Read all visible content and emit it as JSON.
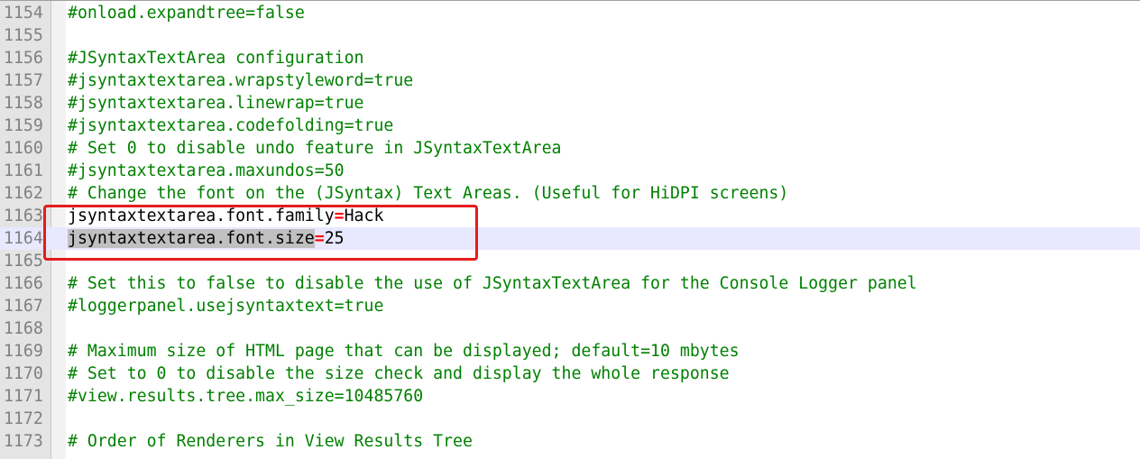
{
  "editor": {
    "lines": [
      {
        "num": "1154",
        "comment": "#onload.expandtree=false"
      },
      {
        "num": "1155",
        "comment": ""
      },
      {
        "num": "1156",
        "comment": "#JSyntaxTextArea configuration"
      },
      {
        "num": "1157",
        "comment": "#jsyntaxtextarea.wrapstyleword=true"
      },
      {
        "num": "1158",
        "comment": "#jsyntaxtextarea.linewrap=true"
      },
      {
        "num": "1159",
        "comment": "#jsyntaxtextarea.codefolding=true"
      },
      {
        "num": "1160",
        "comment": "# Set 0 to disable undo feature in JSyntaxTextArea"
      },
      {
        "num": "1161",
        "comment": "#jsyntaxtextarea.maxundos=50"
      },
      {
        "num": "1162",
        "comment": "# Change the font on the (JSyntax) Text Areas. (Useful for HiDPI screens)"
      },
      {
        "num": "1163",
        "key": "jsyntaxtextarea.font.family",
        "op": "=",
        "value": "Hack"
      },
      {
        "num": "1164",
        "key": "jsyntaxtextarea.font.size",
        "op": "=",
        "value": "25"
      },
      {
        "num": "1165",
        "comment": ""
      },
      {
        "num": "1166",
        "comment": "# Set this to false to disable the use of JSyntaxTextArea for the Console Logger panel"
      },
      {
        "num": "1167",
        "comment": "#loggerpanel.usejsyntaxtext=true"
      },
      {
        "num": "1168",
        "comment": ""
      },
      {
        "num": "1169",
        "comment": "# Maximum size of HTML page that can be displayed; default=10 mbytes"
      },
      {
        "num": "1170",
        "comment": "# Set to 0 to disable the size check and display the whole response"
      },
      {
        "num": "1171",
        "comment": "#view.results.tree.max_size=10485760"
      },
      {
        "num": "1172",
        "comment": ""
      },
      {
        "num": "1173",
        "comment": "# Order of Renderers in View Results Tree"
      }
    ]
  },
  "colors": {
    "comment": "#008000",
    "operator": "#ff0000",
    "current_line": "#e8e8ff",
    "highlight_box": "#e51c1c"
  }
}
